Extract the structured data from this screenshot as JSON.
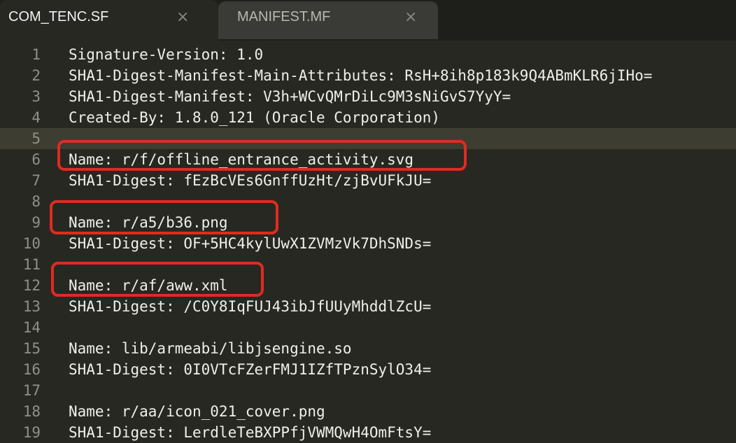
{
  "tabs": [
    {
      "label": "COM_TENC.SF",
      "close": "×",
      "active": true
    },
    {
      "label": "MANIFEST.MF",
      "close": "×",
      "active": false
    }
  ],
  "current_line": 5,
  "lines": [
    {
      "n": "1",
      "text": "Signature-Version: 1.0"
    },
    {
      "n": "2",
      "text": "SHA1-Digest-Manifest-Main-Attributes: RsH+8ih8p183k9Q4ABmKLR6jIHo="
    },
    {
      "n": "3",
      "text": "SHA1-Digest-Manifest: V3h+WCvQMrDiLc9M3sNiGvS7YyY="
    },
    {
      "n": "4",
      "text": "Created-By: 1.8.0_121 (Oracle Corporation)"
    },
    {
      "n": "5",
      "text": ""
    },
    {
      "n": "6",
      "text": "Name: r/f/offline_entrance_activity.svg"
    },
    {
      "n": "7",
      "text": "SHA1-Digest: fEzBcVEs6GnffUzHt/zjBvUFkJU="
    },
    {
      "n": "8",
      "text": ""
    },
    {
      "n": "9",
      "text": "Name: r/a5/b36.png"
    },
    {
      "n": "10",
      "text": "SHA1-Digest: OF+5HC4kylUwX1ZVMzVk7DhSNDs="
    },
    {
      "n": "11",
      "text": ""
    },
    {
      "n": "12",
      "text": "Name: r/af/aww.xml"
    },
    {
      "n": "13",
      "text": "SHA1-Digest: /C0Y8IqFUJ43ibJfUUyMhddlZcU="
    },
    {
      "n": "14",
      "text": ""
    },
    {
      "n": "15",
      "text": "Name: lib/armeabi/libjsengine.so"
    },
    {
      "n": "16",
      "text": "SHA1-Digest: 0I0VTcFZerFMJ1IZfTPznSylO34="
    },
    {
      "n": "17",
      "text": ""
    },
    {
      "n": "18",
      "text": "Name: r/aa/icon_021_cover.png"
    },
    {
      "n": "19",
      "text": "SHA1-Digest: LerdleTeBXPPfjVWMQwH4OmFtsY="
    }
  ],
  "annotation_color": "#e02b20"
}
